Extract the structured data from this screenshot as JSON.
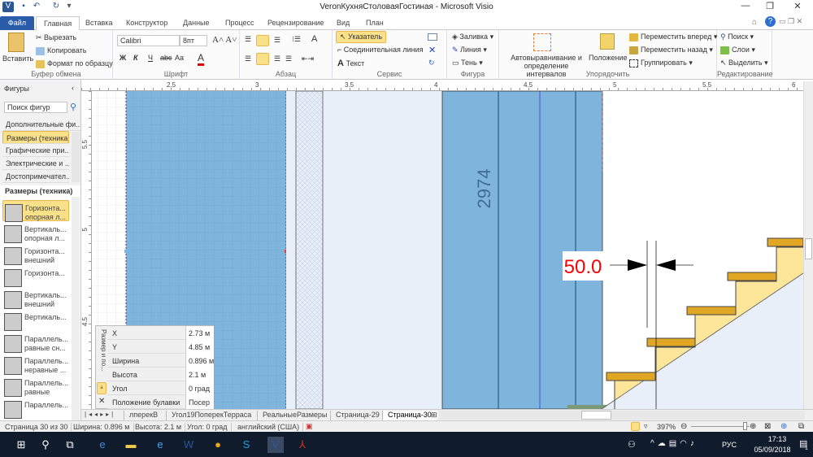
{
  "window": {
    "title": "VeronКухняСтоловаяГостиная - Microsoft Visio",
    "app_icon": "visio-icon",
    "quick_access": [
      "save-icon",
      "undo-icon",
      "redo-icon",
      "customize-icon"
    ]
  },
  "tabs": [
    {
      "label": "Файл"
    },
    {
      "label": "Главная",
      "active": true
    },
    {
      "label": "Вставка"
    },
    {
      "label": "Конструктор"
    },
    {
      "label": "Данные"
    },
    {
      "label": "Процесс"
    },
    {
      "label": "Рецензирование"
    },
    {
      "label": "Вид"
    },
    {
      "label": "План"
    }
  ],
  "ribbon": {
    "clipboard": {
      "label": "Буфер обмена",
      "paste": "Вставить",
      "cut": "Вырезать",
      "copy": "Копировать",
      "format_painter": "Формат по образцу"
    },
    "font": {
      "label": "Шрифт",
      "font_name": "Calibri",
      "font_size": "8пт",
      "bold": "Ж",
      "italic": "К",
      "underline": "Ч",
      "strike": "abc",
      "case": "Aa",
      "color": "A"
    },
    "paragraph": {
      "label": "Абзац"
    },
    "tools": {
      "label": "Сервис",
      "pointer": "Указатель",
      "connector": "Соединительная линия",
      "text": "Текст"
    },
    "shape": {
      "label": "Фигура",
      "fill": "Заливка",
      "line": "Линия",
      "shadow": "Тень"
    },
    "arrange": {
      "label": "Упорядочить",
      "auto_align": "Автовыравнивание и определение интервалов",
      "position": "Положение",
      "bring_forward": "Переместить вперед",
      "send_backward": "Переместить назад",
      "group": "Группировать"
    },
    "editing": {
      "label": "Редактирование",
      "find": "Поиск",
      "layers": "Слои",
      "select": "Выделить"
    }
  },
  "shapes_panel": {
    "title": "Фигуры",
    "search_placeholder": "Поиск фигур",
    "stencils": [
      "Дополнительные фи...",
      "Размеры (техника)",
      "Графические при...",
      "Электрические и ...",
      "Достопримечател..."
    ],
    "active_stencil": "Размеры (техника)",
    "masters": [
      [
        "Горизонта...",
        "опорная л..."
      ],
      [
        "Вертикаль...",
        "опорная л..."
      ],
      [
        "Горизонта...",
        "внешний"
      ],
      [
        "Горизонта...",
        ""
      ],
      [
        "Вертикаль...",
        "внешний"
      ],
      [
        "Вертикаль...",
        ""
      ],
      [
        "Параллель...",
        "равные сн..."
      ],
      [
        "Параллель...",
        "неравные ..."
      ],
      [
        "Параллель...",
        "равные"
      ],
      [
        "Параллель...",
        ""
      ]
    ]
  },
  "rulers": {
    "h": [
      "2.5",
      "3",
      "3.5",
      "4",
      "4.5",
      "5",
      "5.5",
      "6"
    ],
    "v": [
      "5.5",
      "5",
      "4.5"
    ]
  },
  "drawing": {
    "vertical_label": "2974",
    "dimension_value": "50.0",
    "dimension_color": "#ff0000",
    "wall_color": "#7fb5dc",
    "stair_tread_color": "#e0a624",
    "stair_fill": "#fde59a"
  },
  "size_position": {
    "title": "Размер и по...",
    "rows": [
      {
        "k": "X",
        "v": "2.73 м"
      },
      {
        "k": "Y",
        "v": "4.85 м"
      },
      {
        "k": "Ширина",
        "v": "0.896 м"
      },
      {
        "k": "Высота",
        "v": "2.1 м"
      },
      {
        "k": "Угол",
        "v": "0 град"
      },
      {
        "k": "Положение булавки",
        "v": "Посер"
      }
    ]
  },
  "page_tabs": [
    "лперекВ",
    "Угол19ПоперекТерраса",
    "РеальныеРазмеры",
    "Страница-29",
    "Страница-30"
  ],
  "active_page": "Страница-30",
  "status": {
    "page": "Страница 30 из 30",
    "width": "Ширина: 0.896 м",
    "height": "Высота: 2.1 м",
    "angle": "Угол: 0 град",
    "language": "английский (США)",
    "zoom": "397%"
  },
  "taskbar": {
    "apps": [
      "start-icon",
      "search-icon",
      "task-view-icon",
      "edge-icon",
      "explorer-icon",
      "ie-icon",
      "word-icon",
      "chrome-icon",
      "skype-icon",
      "visio-icon",
      "acrobat-icon"
    ],
    "lang": "РУС",
    "time": "17:13",
    "date": "05/09/2018",
    "notifications": "1"
  }
}
